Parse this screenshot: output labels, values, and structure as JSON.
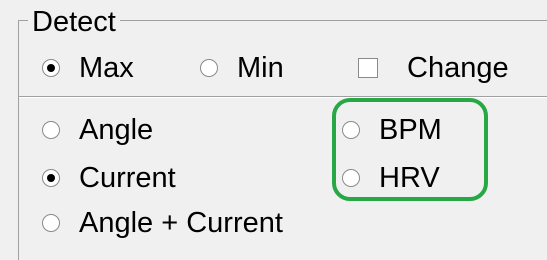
{
  "group": {
    "title": "Detect"
  },
  "mode": {
    "max_label": "Max",
    "min_label": "Min",
    "change_label": "Change",
    "selected": "max",
    "change_checked": false
  },
  "signal": {
    "angle_label": "Angle",
    "current_label": "Current",
    "angle_current_label": "Angle + Current",
    "bpm_label": "BPM",
    "hrv_label": "HRV",
    "selected": "current"
  },
  "colors": {
    "highlight": "#27a845",
    "background": "#f0f0f0"
  }
}
